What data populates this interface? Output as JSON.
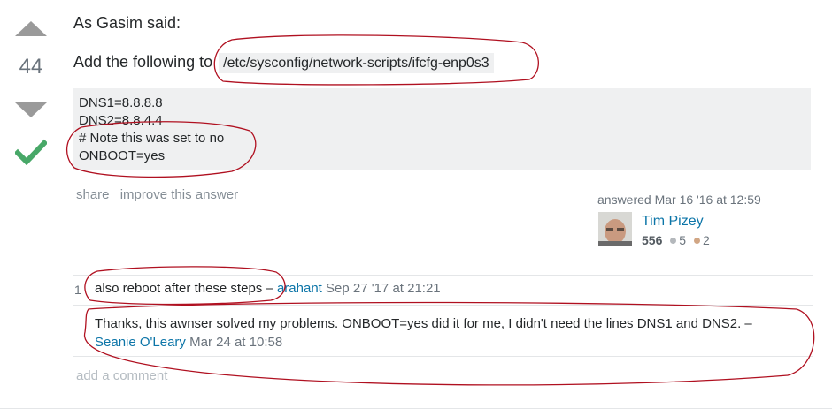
{
  "vote": {
    "count": "44"
  },
  "answer": {
    "line1": "As Gasim said:",
    "line2": "Add the following to",
    "path": "/etc/sysconfig/network-scripts/ifcfg-enp0s3",
    "code": [
      "DNS1=8.8.8.8",
      "DNS2=8.8.4.4",
      "# Note this was set to no",
      "ONBOOT=yes"
    ]
  },
  "post_menu": {
    "share": "share",
    "improve": "improve this answer"
  },
  "signature": {
    "answered": "answered Mar 16 '16 at 12:59",
    "user": "Tim Pizey",
    "reputation": "556",
    "silver": "5",
    "bronze": "2"
  },
  "comments": [
    {
      "score": "1",
      "text": "also reboot after these steps",
      "sep": " – ",
      "user": "arahant",
      "date": "Sep 27 '17 at 21:21"
    },
    {
      "score": "",
      "text": "Thanks, this awnser solved my problems. ONBOOT=yes did it for me, I didn't need the lines DNS1 and DNS2.",
      "sep": " – ",
      "user": "Seanie O'Leary",
      "date": "Mar 24 at 10:58"
    }
  ],
  "add_comment": "add a comment",
  "colors": {
    "link": "#0c75a8",
    "accepted": "#48a868",
    "annotation": "#b01020"
  }
}
